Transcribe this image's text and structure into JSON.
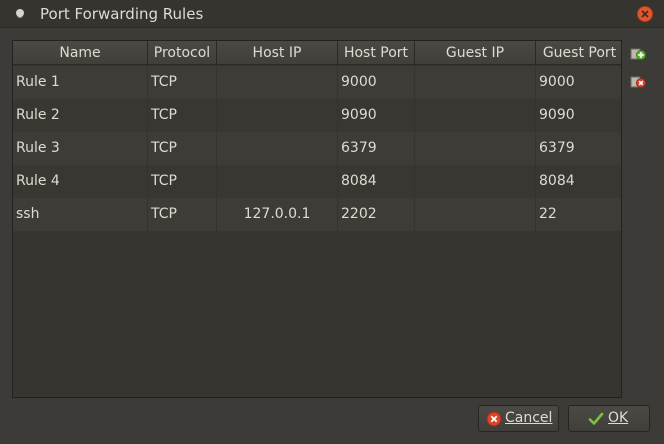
{
  "window": {
    "title": "Port Forwarding Rules"
  },
  "table": {
    "columns": [
      "Name",
      "Protocol",
      "Host IP",
      "Host Port",
      "Guest IP",
      "Guest Port"
    ],
    "rows": [
      {
        "name": "Rule 1",
        "protocol": "TCP",
        "host_ip": "",
        "host_port": "9000",
        "guest_ip": "",
        "guest_port": "9000"
      },
      {
        "name": "Rule 2",
        "protocol": "TCP",
        "host_ip": "",
        "host_port": "9090",
        "guest_ip": "",
        "guest_port": "9090"
      },
      {
        "name": "Rule 3",
        "protocol": "TCP",
        "host_ip": "",
        "host_port": "6379",
        "guest_ip": "",
        "guest_port": "6379"
      },
      {
        "name": "Rule 4",
        "protocol": "TCP",
        "host_ip": "",
        "host_port": "8084",
        "guest_ip": "",
        "guest_port": "8084"
      },
      {
        "name": "ssh",
        "protocol": "TCP",
        "host_ip": "127.0.0.1",
        "host_port": "2202",
        "guest_ip": "",
        "guest_port": "22"
      }
    ]
  },
  "side_actions": {
    "add_icon": "add-rule-icon",
    "remove_icon": "remove-rule-icon"
  },
  "buttons": {
    "cancel": "Cancel",
    "ok": "OK"
  },
  "colors": {
    "accent_add": "#5fb832",
    "accent_remove": "#d9442a",
    "ok_check": "#7ec13d",
    "close": "#e2562f"
  }
}
